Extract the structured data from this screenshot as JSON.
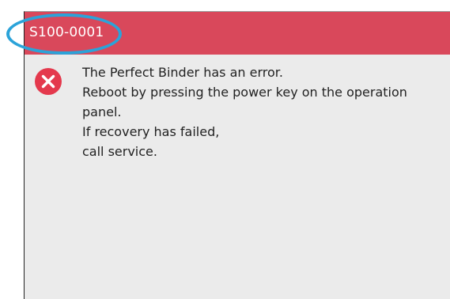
{
  "dialog": {
    "error_code": "S100-0001",
    "icon": "error-x-icon",
    "message_lines": [
      "The Perfect Binder has an error.",
      "Reboot by pressing the power key on the operation",
      "panel.",
      "If recovery has failed,",
      "call service."
    ]
  },
  "colors": {
    "header_red": "#d9485b",
    "panel_gray": "#ebebeb",
    "highlight_blue": "#2ba3d9",
    "icon_red": "#e4394d"
  }
}
